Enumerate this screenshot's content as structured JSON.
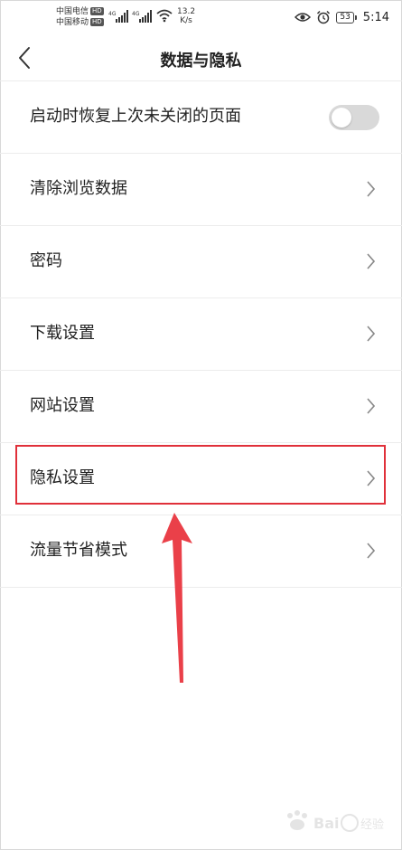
{
  "status_bar": {
    "carrier1": "中国电信",
    "carrier2": "中国移动",
    "hd": "HD",
    "net_gen": "4G",
    "speed_value": "13.2",
    "speed_unit": "K/s",
    "battery": "53",
    "time": "5:14"
  },
  "header": {
    "title": "数据与隐私"
  },
  "settings": {
    "restore_pages": {
      "label": "启动时恢复上次未关闭的页面",
      "enabled": false
    },
    "items": [
      {
        "label": "清除浏览数据"
      },
      {
        "label": "密码"
      },
      {
        "label": "下载设置"
      },
      {
        "label": "网站设置"
      },
      {
        "label": "隐私设置"
      },
      {
        "label": "流量节省模式"
      }
    ]
  },
  "annotation": {
    "highlight_color": "#e0303a"
  },
  "watermark": {
    "text": "Baidu经验"
  }
}
